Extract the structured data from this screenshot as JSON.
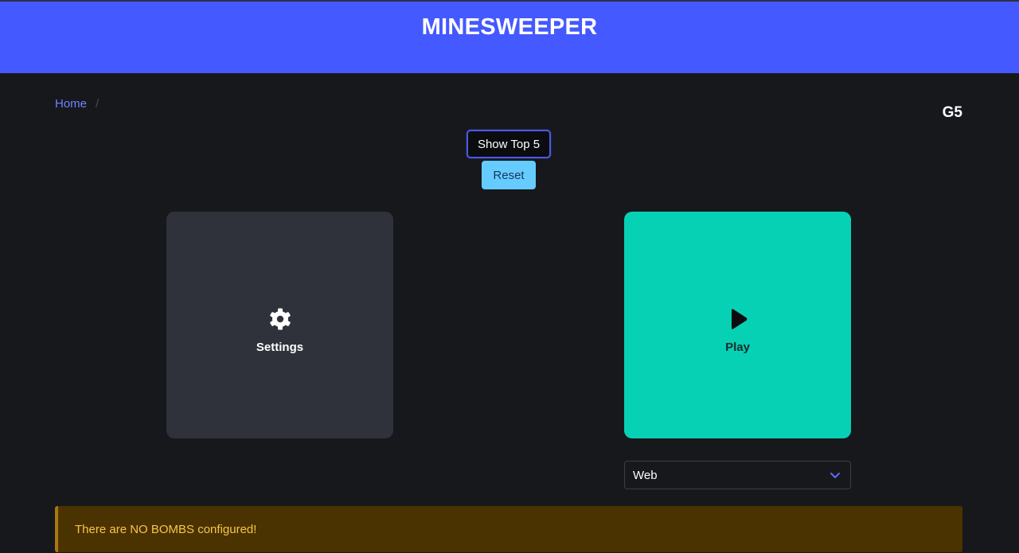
{
  "header": {
    "title": "MINESWEEPER"
  },
  "breadcrumb": {
    "home": "Home",
    "separator": "/"
  },
  "user": {
    "tag": "G5"
  },
  "actions": {
    "show_top_label": "Show Top 5",
    "reset_label": "Reset"
  },
  "tiles": {
    "settings": {
      "label": "Settings",
      "icon": "gear-icon"
    },
    "play": {
      "label": "Play",
      "icon": "play-icon"
    }
  },
  "mode_select": {
    "value": "Web",
    "icon": "chevron-down-icon"
  },
  "notification": {
    "message": "There are NO BOMBS configured!"
  },
  "colors": {
    "header": "#4459ff",
    "background": "#17181c",
    "settings_tile": "#2f323b",
    "play_tile": "#06d1b5",
    "reset_button": "#66ccff",
    "warning_bg": "#4a3300",
    "warning_text": "#f7c54c"
  }
}
